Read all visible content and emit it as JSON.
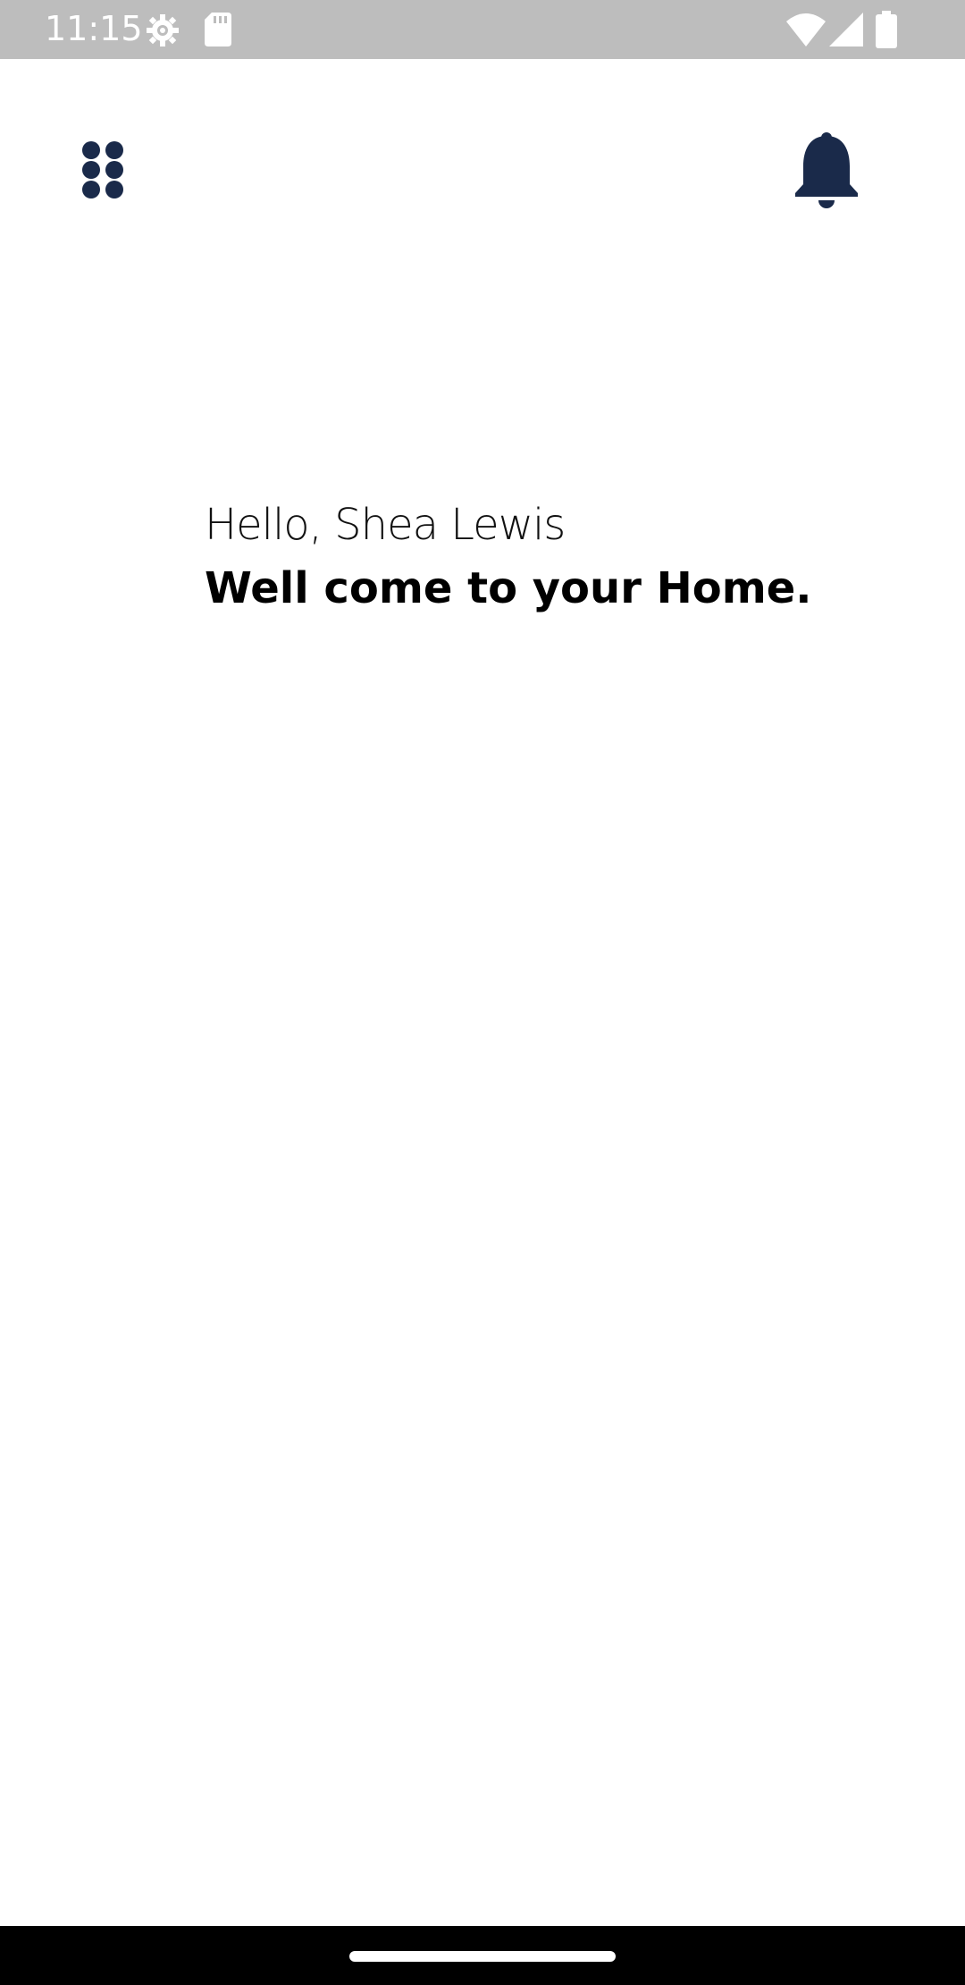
{
  "status_bar": {
    "time": "11:15",
    "icons": [
      "settings-gear-icon",
      "sd-card-icon",
      "wifi-icon",
      "cell-signal-icon",
      "battery-icon"
    ],
    "text_color": "#ffffff",
    "background": "#bdbdbd"
  },
  "app_bar": {
    "menu_icon": "grid-dots-menu-icon",
    "notification_icon": "bell-icon",
    "icon_color": "#1a2a4a"
  },
  "main": {
    "greeting": "Hello, Shea Lewis",
    "welcome": "Well come to your Home."
  },
  "nav_bar": {
    "handle": "home-gesture-handle"
  }
}
